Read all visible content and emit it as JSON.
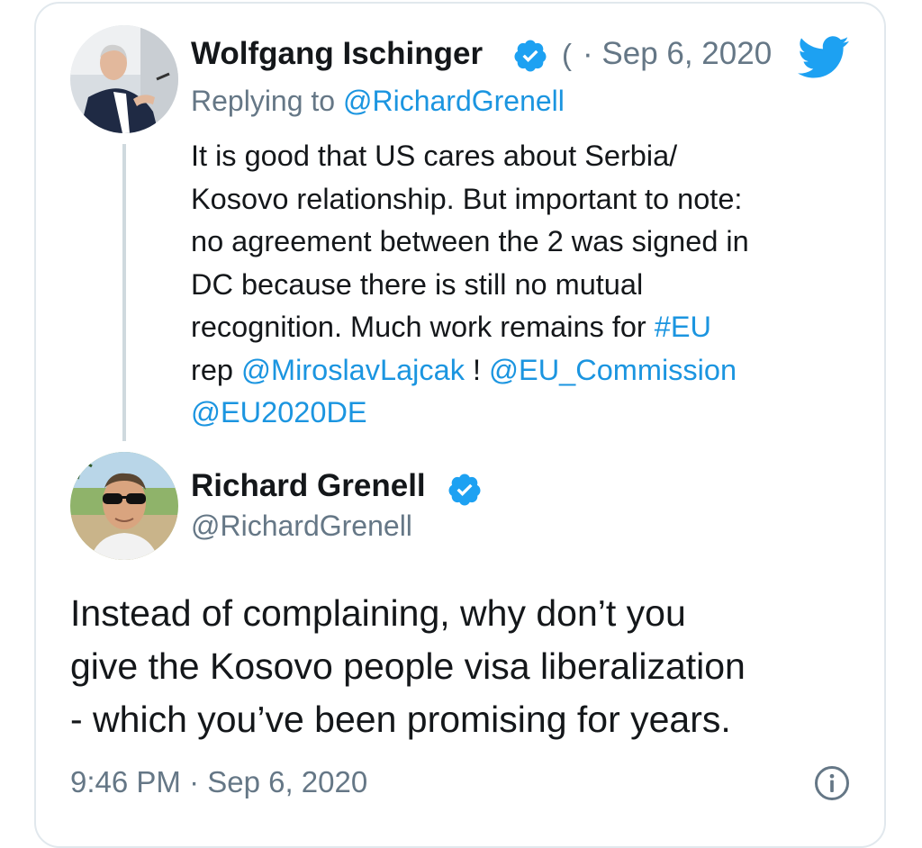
{
  "parent_tweet": {
    "author_name": "Wolfgang Ischinger",
    "verified": true,
    "handle_truncated": "(",
    "separator": "·",
    "date": "Sep 6, 2020",
    "replying_prefix": "Replying to ",
    "replying_handle": "@RichardGrenell",
    "text_lines": [
      "It is good that US cares about Serbia/",
      "Kosovo relationship. But important to note:",
      "no agreement between the 2 was signed in",
      "DC  because there is still no mutual",
      "recognition. Much work remains for "
    ],
    "hashtag": "#EU",
    "line6_prefix": "rep ",
    "mention_1": "@MiroslavLajcak",
    "line6_mid": " ! ",
    "mention_2": "@EU_Commission",
    "mention_3": "@EU2020DE"
  },
  "reply_tweet": {
    "author_name": "Richard Grenell",
    "verified": true,
    "handle": "@RichardGrenell",
    "text_lines": [
      "Instead of complaining, why don’t you",
      "give the Kosovo people visa liberalization",
      "- which you’ve been promising for years."
    ],
    "timestamp": "9:46 PM · Sep 6, 2020"
  },
  "icons": {
    "brand": "twitter-bird-icon",
    "verified": "verified-badge-icon",
    "info": "info-icon"
  },
  "colors": {
    "link": "#1b95e0",
    "verified": "#1da1f2",
    "secondary_text": "#657786",
    "primary_text": "#14171a",
    "border": "#e1e8ed"
  }
}
